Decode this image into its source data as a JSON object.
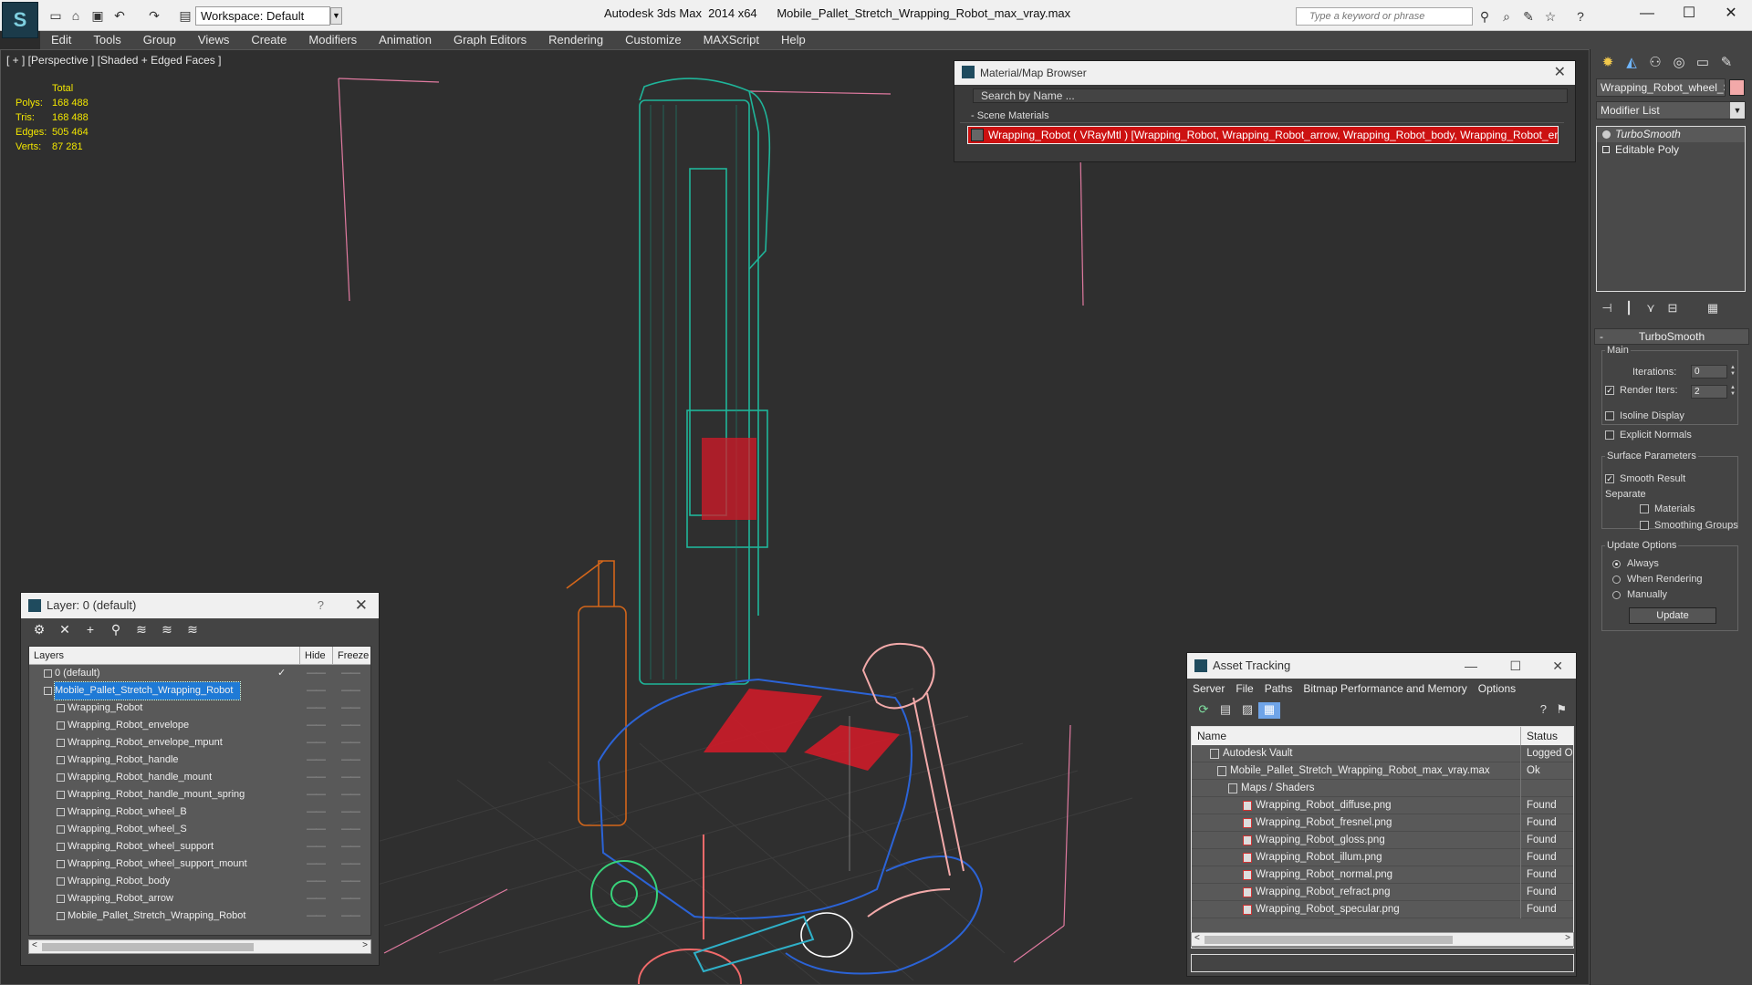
{
  "titlebar": {
    "app_title": "Autodesk 3ds Max  2014 x64",
    "file_title": "Mobile_Pallet_Stretch_Wrapping_Robot_max_vray.max",
    "workspace": "Workspace: Default",
    "search_placeholder": "Type a keyword or phrase"
  },
  "menubar": [
    "Edit",
    "Tools",
    "Group",
    "Views",
    "Create",
    "Modifiers",
    "Animation",
    "Graph Editors",
    "Rendering",
    "Customize",
    "MAXScript",
    "Help"
  ],
  "viewport": {
    "label": "[ + ] [Perspective ] [Shaded + Edged Faces ]",
    "stats_header": "Total",
    "stats": [
      {
        "k": "Polys:",
        "v": "168 488"
      },
      {
        "k": "Tris:",
        "v": "168 488"
      },
      {
        "k": "Edges:",
        "v": "505 464"
      },
      {
        "k": "Verts:",
        "v": "87 281"
      }
    ]
  },
  "material_browser": {
    "title": "Material/Map Browser",
    "search": "Search by Name ...",
    "section": "- Scene Materials",
    "item": "Wrapping_Robot ( VRayMtl ) [Wrapping_Robot, Wrapping_Robot_arrow, Wrapping_Robot_body, Wrapping_Robot_envel..."
  },
  "command_panel": {
    "object_name": "Wrapping_Robot_wheel_S",
    "object_color": "#f2a9a9",
    "modifier_list": "Modifier List",
    "stack": [
      "TurboSmooth",
      "Editable Poly"
    ],
    "rollout_title": "TurboSmooth",
    "main_label": "Main",
    "iterations_label": "Iterations:",
    "iterations_value": "0",
    "render_iters_label": "Render Iters:",
    "render_iters_value": "2",
    "isoline": "Isoline Display",
    "explicit_normals": "Explicit Normals",
    "surface_params": "Surface Parameters",
    "smooth_result": "Smooth Result",
    "separate": "Separate",
    "materials": "Materials",
    "smoothing_groups": "Smoothing Groups",
    "update_options": "Update Options",
    "always": "Always",
    "when_rendering": "When Rendering",
    "manually": "Manually",
    "update_btn": "Update"
  },
  "layer_window": {
    "title": "Layer: 0 (default)",
    "col_layers": "Layers",
    "col_hide": "Hide",
    "col_freeze": "Freeze",
    "rows": [
      {
        "name": "0 (default)",
        "level": 0
      },
      {
        "name": "Mobile_Pallet_Stretch_Wrapping_Robot",
        "level": 0
      },
      {
        "name": "Wrapping_Robot",
        "level": 1
      },
      {
        "name": "Wrapping_Robot_envelope",
        "level": 1
      },
      {
        "name": "Wrapping_Robot_envelope_mpunt",
        "level": 1
      },
      {
        "name": "Wrapping_Robot_handle",
        "level": 1
      },
      {
        "name": "Wrapping_Robot_handle_mount",
        "level": 1
      },
      {
        "name": "Wrapping_Robot_handle_mount_spring",
        "level": 1
      },
      {
        "name": "Wrapping_Robot_wheel_B",
        "level": 1
      },
      {
        "name": "Wrapping_Robot_wheel_S",
        "level": 1
      },
      {
        "name": "Wrapping_Robot_wheel_support",
        "level": 1
      },
      {
        "name": "Wrapping_Robot_wheel_support_mount",
        "level": 1
      },
      {
        "name": "Wrapping_Robot_body",
        "level": 1
      },
      {
        "name": "Wrapping_Robot_arrow",
        "level": 1
      },
      {
        "name": "Mobile_Pallet_Stretch_Wrapping_Robot",
        "level": 1
      }
    ]
  },
  "asset_tracking": {
    "title": "Asset Tracking",
    "menu": [
      "Server",
      "File",
      "Paths",
      "Bitmap Performance and Memory",
      "Options"
    ],
    "col_name": "Name",
    "col_status": "Status",
    "rows": [
      {
        "name": "Autodesk Vault",
        "status": "Logged O"
      },
      {
        "name": "Mobile_Pallet_Stretch_Wrapping_Robot_max_vray.max",
        "status": "Ok"
      },
      {
        "name": "Maps / Shaders",
        "status": ""
      },
      {
        "name": "Wrapping_Robot_diffuse.png",
        "status": "Found"
      },
      {
        "name": "Wrapping_Robot_fresnel.png",
        "status": "Found"
      },
      {
        "name": "Wrapping_Robot_gloss.png",
        "status": "Found"
      },
      {
        "name": "Wrapping_Robot_illum.png",
        "status": "Found"
      },
      {
        "name": "Wrapping_Robot_normal.png",
        "status": "Found"
      },
      {
        "name": "Wrapping_Robot_refract.png",
        "status": "Found"
      },
      {
        "name": "Wrapping_Robot_specular.png",
        "status": "Found"
      }
    ]
  }
}
